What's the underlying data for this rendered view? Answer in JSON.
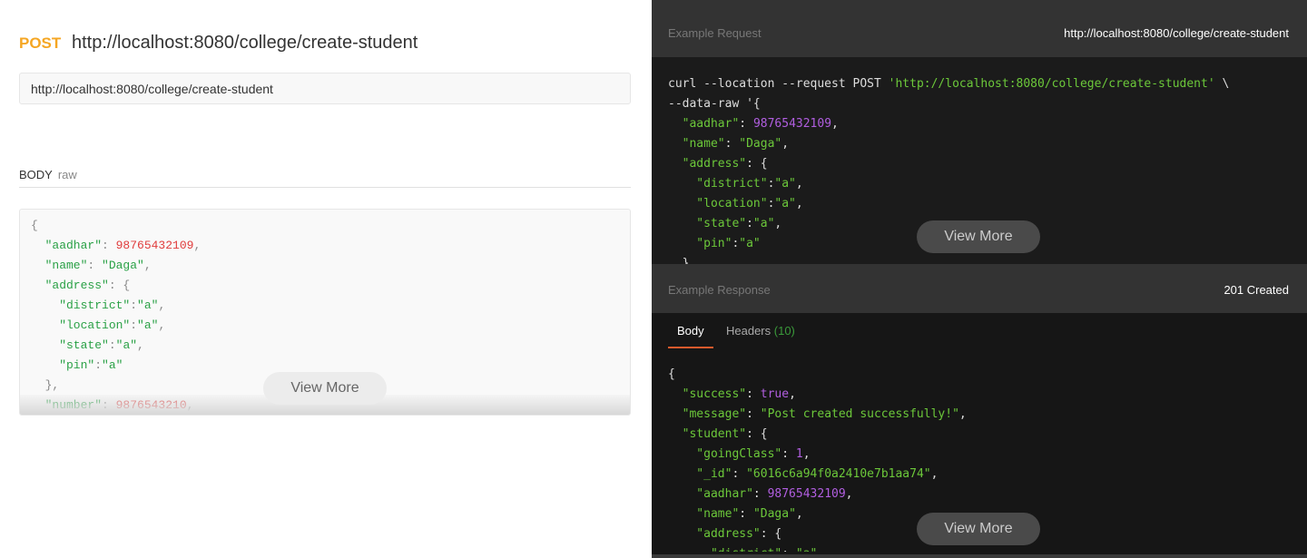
{
  "request": {
    "method": "POST",
    "title_url": "http://localhost:8080/college/create-student",
    "url_value": "http://localhost:8080/college/create-student",
    "body_label": "BODY",
    "body_type": "raw",
    "view_more": "View More",
    "body_lines": [
      [
        [
          "p",
          "{"
        ]
      ],
      [
        [
          "k",
          "  \"aadhar\""
        ],
        [
          "p",
          ": "
        ],
        [
          "n",
          "98765432109"
        ],
        [
          "p",
          ","
        ]
      ],
      [
        [
          "k",
          "  \"name\""
        ],
        [
          "p",
          ": "
        ],
        [
          "s",
          "\"Daga\""
        ],
        [
          "p",
          ","
        ]
      ],
      [
        [
          "k",
          "  \"address\""
        ],
        [
          "p",
          ": {"
        ]
      ],
      [
        [
          "k",
          "    \"district\""
        ],
        [
          "p",
          ":"
        ],
        [
          "s",
          "\"a\""
        ],
        [
          "p",
          ","
        ]
      ],
      [
        [
          "k",
          "    \"location\""
        ],
        [
          "p",
          ":"
        ],
        [
          "s",
          "\"a\""
        ],
        [
          "p",
          ","
        ]
      ],
      [
        [
          "k",
          "    \"state\""
        ],
        [
          "p",
          ":"
        ],
        [
          "s",
          "\"a\""
        ],
        [
          "p",
          ","
        ]
      ],
      [
        [
          "k",
          "    \"pin\""
        ],
        [
          "p",
          ":"
        ],
        [
          "s",
          "\"a\""
        ]
      ],
      [
        [
          "p",
          "  },"
        ]
      ],
      [
        [
          "k",
          "  \"number\""
        ],
        [
          "p",
          ": "
        ],
        [
          "n",
          "9876543210"
        ],
        [
          "p",
          ","
        ]
      ]
    ]
  },
  "example_request": {
    "label": "Example Request",
    "url": "http://localhost:8080/college/create-student",
    "view_more": "View More",
    "lines": [
      [
        [
          "p",
          "curl --location --request POST "
        ],
        [
          "s",
          "'http://localhost:8080/college/create-student'"
        ],
        [
          "p",
          " \\"
        ]
      ],
      [
        [
          "p",
          "--data-raw '{"
        ]
      ],
      [
        [
          "k",
          "  \"aadhar\""
        ],
        [
          "p",
          ": "
        ],
        [
          "n",
          "98765432109"
        ],
        [
          "p",
          ","
        ]
      ],
      [
        [
          "k",
          "  \"name\""
        ],
        [
          "p",
          ": "
        ],
        [
          "s",
          "\"Daga\""
        ],
        [
          "p",
          ","
        ]
      ],
      [
        [
          "k",
          "  \"address\""
        ],
        [
          "p",
          ": {"
        ]
      ],
      [
        [
          "k",
          "    \"district\""
        ],
        [
          "p",
          ":"
        ],
        [
          "s",
          "\"a\""
        ],
        [
          "p",
          ","
        ]
      ],
      [
        [
          "k",
          "    \"location\""
        ],
        [
          "p",
          ":"
        ],
        [
          "s",
          "\"a\""
        ],
        [
          "p",
          ","
        ]
      ],
      [
        [
          "k",
          "    \"state\""
        ],
        [
          "p",
          ":"
        ],
        [
          "s",
          "\"a\""
        ],
        [
          "p",
          ","
        ]
      ],
      [
        [
          "k",
          "    \"pin\""
        ],
        [
          "p",
          ":"
        ],
        [
          "s",
          "\"a\""
        ]
      ],
      [
        [
          "p",
          "  }"
        ]
      ]
    ]
  },
  "example_response": {
    "label": "Example Response",
    "status": "201 Created",
    "tabs": {
      "body": "Body",
      "headers": "Headers",
      "headers_count": "(10)"
    },
    "view_more": "View More",
    "lines": [
      [
        [
          "p",
          "{"
        ]
      ],
      [
        [
          "k",
          "  \"success\""
        ],
        [
          "p",
          ": "
        ],
        [
          "n",
          "true"
        ],
        [
          "p",
          ","
        ]
      ],
      [
        [
          "k",
          "  \"message\""
        ],
        [
          "p",
          ": "
        ],
        [
          "s",
          "\"Post created successfully!\""
        ],
        [
          "p",
          ","
        ]
      ],
      [
        [
          "k",
          "  \"student\""
        ],
        [
          "p",
          ": {"
        ]
      ],
      [
        [
          "k",
          "    \"goingClass\""
        ],
        [
          "p",
          ": "
        ],
        [
          "n",
          "1"
        ],
        [
          "p",
          ","
        ]
      ],
      [
        [
          "k",
          "    \"_id\""
        ],
        [
          "p",
          ": "
        ],
        [
          "s",
          "\"6016c6a94f0a2410e7b1aa74\""
        ],
        [
          "p",
          ","
        ]
      ],
      [
        [
          "k",
          "    \"aadhar\""
        ],
        [
          "p",
          ": "
        ],
        [
          "n",
          "98765432109"
        ],
        [
          "p",
          ","
        ]
      ],
      [
        [
          "k",
          "    \"name\""
        ],
        [
          "p",
          ": "
        ],
        [
          "s",
          "\"Daga\""
        ],
        [
          "p",
          ","
        ]
      ],
      [
        [
          "k",
          "    \"address\""
        ],
        [
          "p",
          ": {"
        ]
      ],
      [
        [
          "k",
          "      \"district\""
        ],
        [
          "p",
          ": "
        ],
        [
          "s",
          "\"a\""
        ],
        [
          "p",
          ","
        ]
      ]
    ]
  },
  "colors": {
    "method": "#f5a623",
    "key_string_dark": "#6cc83a",
    "number_dark": "#b15ee0",
    "number_light": "#e03c3c",
    "tab_underline": "#e05a2c"
  }
}
